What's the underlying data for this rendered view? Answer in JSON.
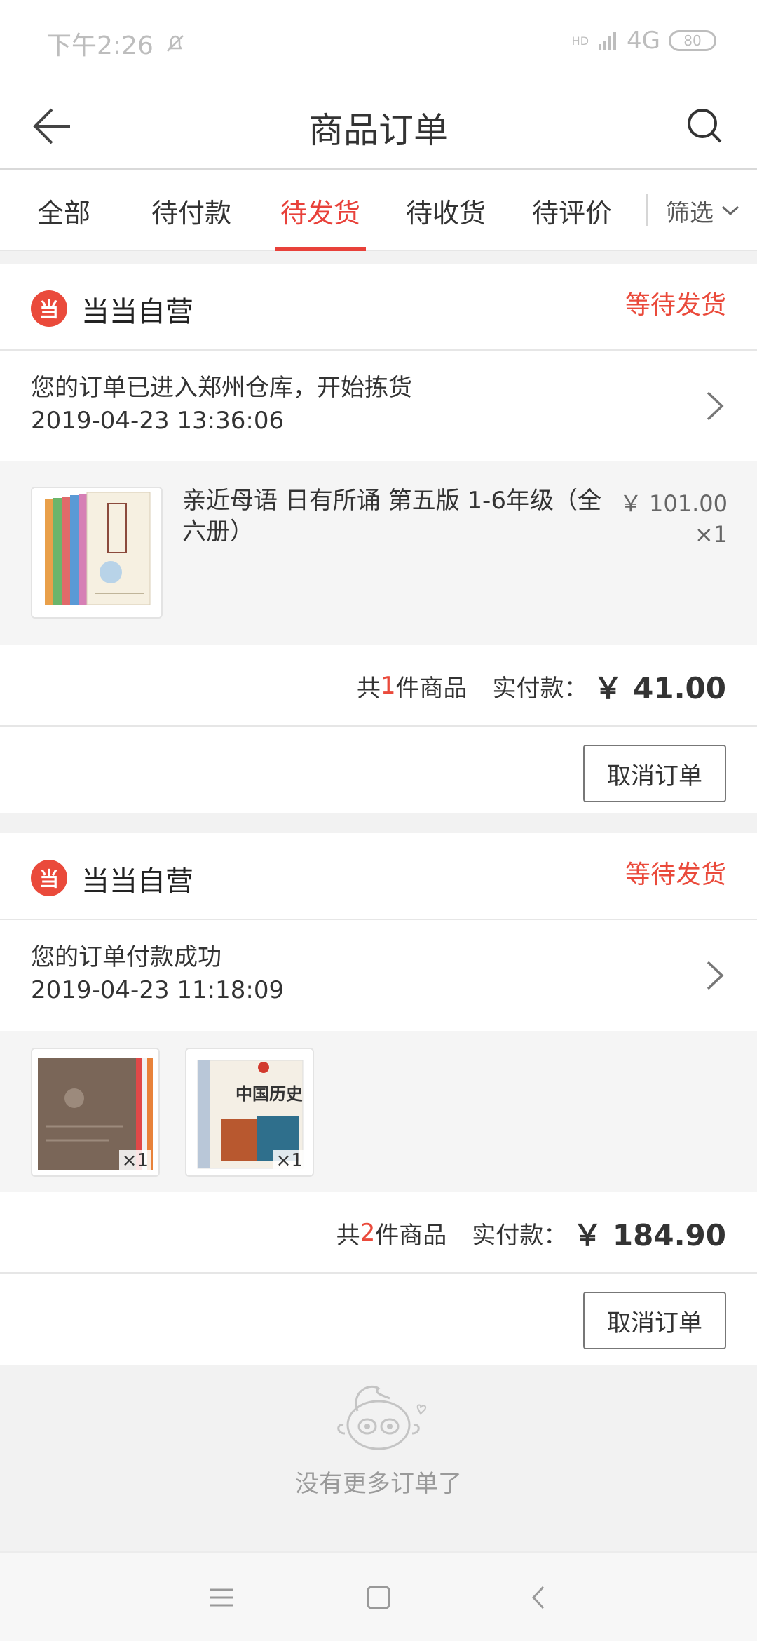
{
  "status_bar": {
    "time": "下午2:26",
    "network": "4G",
    "hd": "HD",
    "battery": "80"
  },
  "header": {
    "title": "商品订单"
  },
  "tabs": [
    {
      "label": "全部"
    },
    {
      "label": "待付款"
    },
    {
      "label": "待发货",
      "active": true
    },
    {
      "label": "待收货"
    },
    {
      "label": "待评价"
    }
  ],
  "filter": {
    "label": "筛选"
  },
  "orders": [
    {
      "store": "当当自营",
      "logo_text": "当",
      "status": "等待发货",
      "tracking": {
        "message": "您的订单已进入郑州仓库，开始拣货",
        "time": "2019-04-23 13:36:06"
      },
      "items": [
        {
          "title": "亲近母语 日有所诵 第五版 1-6年级（全六册）",
          "price": "￥ 101.00",
          "qty": "×1"
        }
      ],
      "summary": {
        "prefix": "共",
        "count": "1",
        "suffix": "件商品",
        "paid_label": "实付款：",
        "paid_value": "￥ 41.00"
      },
      "action": "取消订单"
    },
    {
      "store": "当当自营",
      "logo_text": "当",
      "status": "等待发货",
      "tracking": {
        "message": "您的订单付款成功",
        "time": "2019-04-23 11:18:09"
      },
      "items": [
        {
          "qty": "×1"
        },
        {
          "qty": "×1",
          "cover_title": "中国历史"
        }
      ],
      "summary": {
        "prefix": "共",
        "count": "2",
        "suffix": "件商品",
        "paid_label": "实付款：",
        "paid_value": "￥ 184.90"
      },
      "action": "取消订单"
    }
  ],
  "footer": {
    "no_more": "没有更多订单了"
  },
  "colors": {
    "accent": "#e8413a",
    "background": "#f2f2f2"
  }
}
